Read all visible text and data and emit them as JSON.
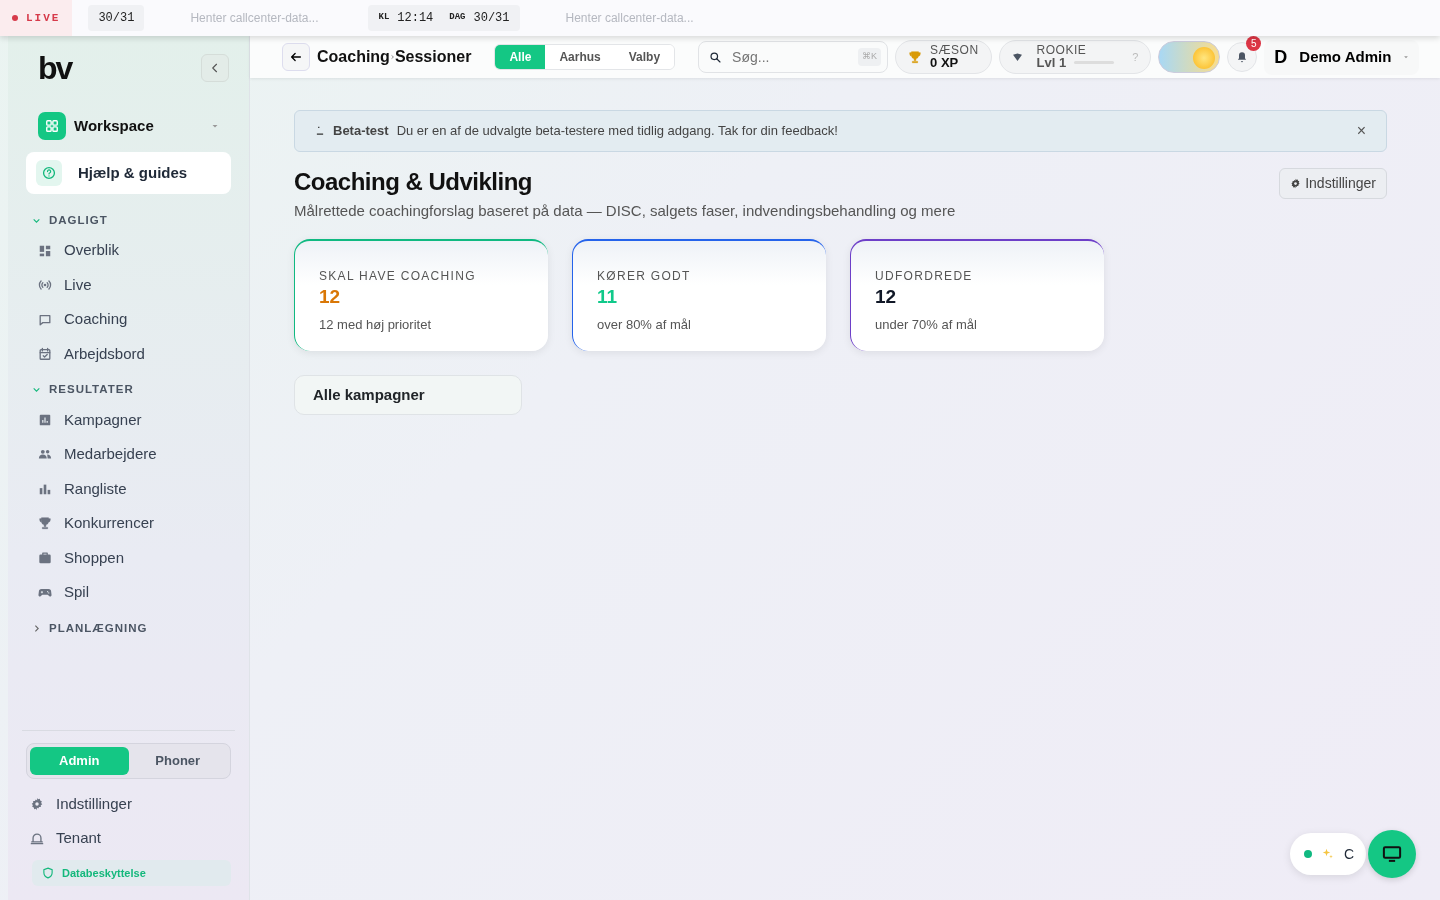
{
  "ticker": {
    "live": "LIVE",
    "items": [
      {
        "kind": "count",
        "value": "30/31"
      },
      {
        "kind": "status",
        "value": "Henter callcenter-data..."
      },
      {
        "kind": "clock",
        "parts": [
          {
            "label": "KL",
            "value": "12:14"
          },
          {
            "label": "DAG",
            "value": "30/31"
          }
        ]
      },
      {
        "kind": "status",
        "value": "Henter callcenter-data..."
      }
    ]
  },
  "sidebar": {
    "logo": "bv",
    "workspace": "Workspace",
    "help": {
      "label": "Hjælp & guides",
      "selected": true
    },
    "sections": [
      {
        "title": "DAGLIGT",
        "expanded": true,
        "items": [
          {
            "label": "Overblik"
          },
          {
            "label": "Live"
          },
          {
            "label": "Coaching"
          },
          {
            "label": "Arbejdsbord"
          }
        ]
      },
      {
        "title": "RESULTATER",
        "expanded": true,
        "items": [
          {
            "label": "Kampagner"
          },
          {
            "label": "Medarbejdere"
          },
          {
            "label": "Rangliste"
          },
          {
            "label": "Konkurrencer"
          },
          {
            "label": "Shoppen"
          },
          {
            "label": "Spil"
          }
        ]
      },
      {
        "title": "PLANLÆGNING",
        "expanded": false
      }
    ],
    "roles": [
      {
        "label": "Admin",
        "selected": true
      },
      {
        "label": "Phoner",
        "selected": false
      }
    ],
    "footer_items": [
      {
        "label": "Indstillinger"
      },
      {
        "label": "Tenant"
      }
    ],
    "privacy": "Databeskyttelse"
  },
  "header": {
    "breadcrumb": [
      "Coaching",
      "Sessioner"
    ],
    "tabs": [
      {
        "label": "Alle",
        "selected": true
      },
      {
        "label": "Aarhus",
        "selected": false
      },
      {
        "label": "Valby",
        "selected": false
      }
    ],
    "search": {
      "placeholder": "Søg...",
      "shortcut": "⌘K"
    },
    "season": {
      "label": "SÆSON",
      "value": "0 XP"
    },
    "rank": {
      "label": "ROOKIE",
      "value": "Lvl 1",
      "level": 0,
      "help": "?"
    },
    "theme_toggle": {
      "on": true
    },
    "notifications": "5",
    "user": {
      "initial": "D",
      "name": "Demo Admin"
    }
  },
  "alert": {
    "title": "Beta-test",
    "text": "Du er en af de udvalgte beta-testere med tidlig adgang. Tak for din feedback!",
    "close": "×"
  },
  "page": {
    "title": "Coaching & Udvikling",
    "subtitle": "Målrettede coachingforslag baseret på data — DISC, salgets faser, indvendingsbehandling og mere",
    "settings_button": "Indstillinger"
  },
  "stats": [
    {
      "label": "SKAL HAVE COACHING",
      "value": "12",
      "note": "12 med høj prioritet",
      "color": "#10b981",
      "kind": "warning"
    },
    {
      "label": "KØRER GODT",
      "value": "11",
      "note": "over 80% af mål",
      "color": "#2563eb",
      "kind": "success"
    },
    {
      "label": "UDFORDREDE",
      "value": "12",
      "note": "under 70% af mål",
      "color": "#6d3fc8",
      "kind": "neutral"
    }
  ],
  "campaign_select": {
    "value": "Alle kampagner"
  },
  "widget": {
    "online": true,
    "text": "C"
  }
}
